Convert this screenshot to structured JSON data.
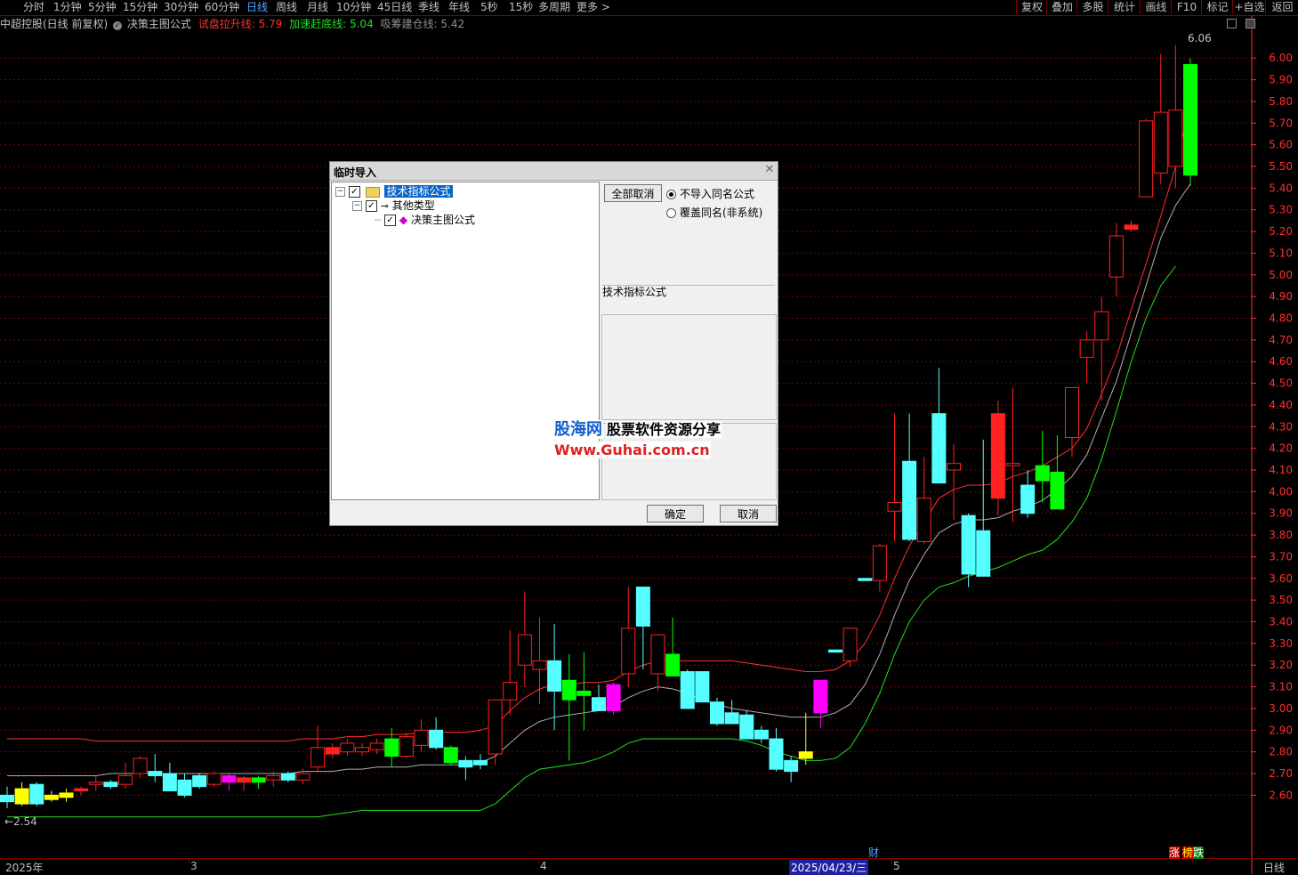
{
  "toolbar": {
    "periods": [
      "分时",
      "1分钟",
      "5分钟",
      "15分钟",
      "30分钟",
      "60分钟",
      "日线",
      "周线",
      "月线",
      "10分钟",
      "45日线",
      "季线",
      "年线",
      "5秒",
      "15秒",
      "多周期",
      "更多 >"
    ],
    "active_period": "日线",
    "right_buttons": [
      "复权",
      "叠加",
      "多股",
      "统计",
      "画线",
      "F10",
      "标记",
      "+自选",
      "返回"
    ]
  },
  "legend": {
    "stock": "中超控股(日线 前复权)",
    "formula": "决策主图公式",
    "line1_label": "试盘拉升线:",
    "line1_value": "5.79",
    "line2_label": "加速赶底线:",
    "line2_value": "5.04",
    "line3_label": "吸筹建仓线:",
    "line3_value": "5.42"
  },
  "annotations": {
    "high": "6.06",
    "low": "2.54",
    "fin_marker": "财",
    "zhang": "涨",
    "bang": "榜",
    "die": "跌"
  },
  "xaxis": {
    "year": "2025年",
    "m3": "3",
    "m4": "4",
    "m5": "5",
    "cursor_date": "2025/04/23/三",
    "period_label": "日线"
  },
  "dialog": {
    "title": "临时导入",
    "tree": {
      "root": "技术指标公式",
      "child": "其他类型",
      "leaf": "决策主图公式"
    },
    "cancel_all": "全部取消",
    "radio1": "不导入同名公式",
    "radio2": "覆盖同名(非系统)",
    "group_label": "技术指标公式",
    "ok": "确定",
    "cancel": "取消"
  },
  "watermark": {
    "brand": "股海网",
    "slogan": "股票软件资源分享",
    "url": "Www.Guhai.com.cn"
  },
  "colors": {
    "up": "#ff2020",
    "down": "#55ffff",
    "line1": "#ff3030",
    "line2": "#b0b0b0",
    "line3": "#20e020",
    "special_green": "#00ff00",
    "special_yellow": "#ffff00",
    "special_magenta": "#ff00ff",
    "grid": "#800000",
    "axis": "#ff3030"
  },
  "chart_data": {
    "type": "candlestick",
    "yticks": [
      2.6,
      2.7,
      2.8,
      2.9,
      3.0,
      3.1,
      3.2,
      3.3,
      3.4,
      3.5,
      3.6,
      3.7,
      3.8,
      3.9,
      4.0,
      4.1,
      4.2,
      4.3,
      4.4,
      4.5,
      4.6,
      4.7,
      4.8,
      4.9,
      5.0,
      5.1,
      5.2,
      5.3,
      5.4,
      5.5,
      5.6,
      5.7,
      5.8,
      5.9,
      6.0
    ],
    "ylim": [
      2.31,
      6.12
    ],
    "candles": [
      {
        "o": 2.6,
        "h": 2.64,
        "l": 2.54,
        "c": 2.57,
        "col": "cyan"
      },
      {
        "o": 2.63,
        "h": 2.66,
        "l": 2.55,
        "c": 2.56,
        "col": "yellow"
      },
      {
        "o": 2.56,
        "h": 2.66,
        "l": 2.55,
        "c": 2.65,
        "col": "cyan"
      },
      {
        "o": 2.6,
        "h": 2.62,
        "l": 2.57,
        "c": 2.58,
        "col": "yellow"
      },
      {
        "o": 2.61,
        "h": 2.63,
        "l": 2.57,
        "c": 2.59,
        "col": "yellow"
      },
      {
        "o": 2.63,
        "h": 2.64,
        "l": 2.6,
        "c": 2.62,
        "col": "red"
      },
      {
        "o": 2.65,
        "h": 2.69,
        "l": 2.62,
        "c": 2.66,
        "col": "red"
      },
      {
        "o": 2.66,
        "h": 2.67,
        "l": 2.63,
        "c": 2.64,
        "col": "cyan"
      },
      {
        "o": 2.65,
        "h": 2.75,
        "l": 2.63,
        "c": 2.69,
        "col": "red"
      },
      {
        "o": 2.7,
        "h": 2.78,
        "l": 2.68,
        "c": 2.77,
        "col": "red"
      },
      {
        "o": 2.71,
        "h": 2.79,
        "l": 2.66,
        "c": 2.69,
        "col": "cyan"
      },
      {
        "o": 2.7,
        "h": 2.75,
        "l": 2.65,
        "c": 2.62,
        "col": "cyan"
      },
      {
        "o": 2.67,
        "h": 2.7,
        "l": 2.59,
        "c": 2.6,
        "col": "cyan"
      },
      {
        "o": 2.69,
        "h": 2.7,
        "l": 2.63,
        "c": 2.64,
        "col": "cyan"
      },
      {
        "o": 2.65,
        "h": 2.71,
        "l": 2.64,
        "c": 2.7,
        "col": "red"
      },
      {
        "o": 2.69,
        "h": 2.7,
        "l": 2.62,
        "c": 2.66,
        "col": "magenta"
      },
      {
        "o": 2.68,
        "h": 2.69,
        "l": 2.62,
        "c": 2.66,
        "col": "red"
      },
      {
        "o": 2.66,
        "h": 2.69,
        "l": 2.63,
        "c": 2.68,
        "col": "green"
      },
      {
        "o": 2.67,
        "h": 2.71,
        "l": 2.64,
        "c": 2.69,
        "col": "red"
      },
      {
        "o": 2.7,
        "h": 2.71,
        "l": 2.66,
        "c": 2.67,
        "col": "cyan"
      },
      {
        "o": 2.67,
        "h": 2.72,
        "l": 2.65,
        "c": 2.7,
        "col": "red"
      },
      {
        "o": 2.73,
        "h": 2.92,
        "l": 2.71,
        "c": 2.82,
        "col": "red"
      },
      {
        "o": 2.82,
        "h": 2.84,
        "l": 2.77,
        "c": 2.79,
        "col": "red"
      },
      {
        "o": 2.8,
        "h": 2.86,
        "l": 2.78,
        "c": 2.84,
        "col": "red"
      },
      {
        "o": 2.8,
        "h": 2.84,
        "l": 2.78,
        "c": 2.82,
        "col": "red"
      },
      {
        "o": 2.81,
        "h": 2.86,
        "l": 2.79,
        "c": 2.84,
        "col": "red"
      },
      {
        "o": 2.86,
        "h": 2.91,
        "l": 2.73,
        "c": 2.78,
        "col": "green"
      },
      {
        "o": 2.78,
        "h": 2.89,
        "l": 2.77,
        "c": 2.87,
        "col": "red"
      },
      {
        "o": 2.83,
        "h": 2.95,
        "l": 2.8,
        "c": 2.9,
        "col": "red"
      },
      {
        "o": 2.9,
        "h": 2.96,
        "l": 2.81,
        "c": 2.82,
        "col": "cyan"
      },
      {
        "o": 2.82,
        "h": 2.83,
        "l": 2.74,
        "c": 2.75,
        "col": "green"
      },
      {
        "o": 2.76,
        "h": 2.78,
        "l": 2.67,
        "c": 2.73,
        "col": "cyan"
      },
      {
        "o": 2.76,
        "h": 2.79,
        "l": 2.72,
        "c": 2.74,
        "col": "cyan"
      },
      {
        "o": 2.79,
        "h": 3.04,
        "l": 2.74,
        "c": 3.04,
        "col": "red"
      },
      {
        "o": 3.04,
        "h": 3.36,
        "l": 2.97,
        "c": 3.12,
        "col": "red"
      },
      {
        "o": 3.2,
        "h": 3.54,
        "l": 3.1,
        "c": 3.34,
        "col": "red"
      },
      {
        "o": 3.18,
        "h": 3.42,
        "l": 3.02,
        "c": 3.22,
        "col": "red"
      },
      {
        "o": 3.22,
        "h": 3.39,
        "l": 2.9,
        "c": 3.08,
        "col": "cyan"
      },
      {
        "o": 3.13,
        "h": 3.25,
        "l": 2.76,
        "c": 3.04,
        "col": "green"
      },
      {
        "o": 3.08,
        "h": 3.26,
        "l": 2.9,
        "c": 3.06,
        "col": "green"
      },
      {
        "o": 3.05,
        "h": 3.11,
        "l": 2.99,
        "c": 2.99,
        "col": "cyan"
      },
      {
        "o": 2.99,
        "h": 3.12,
        "l": 2.97,
        "c": 3.11,
        "col": "magenta"
      },
      {
        "o": 3.16,
        "h": 3.56,
        "l": 3.1,
        "c": 3.37,
        "col": "red"
      },
      {
        "o": 3.56,
        "h": 3.56,
        "l": 3.18,
        "c": 3.38,
        "col": "cyan"
      },
      {
        "o": 3.16,
        "h": 3.28,
        "l": 3.08,
        "c": 3.34,
        "col": "red"
      },
      {
        "o": 3.25,
        "h": 3.42,
        "l": 3.17,
        "c": 3.15,
        "col": "green"
      },
      {
        "o": 3.17,
        "h": 3.18,
        "l": 3.0,
        "c": 3.0,
        "col": "cyan"
      },
      {
        "o": 3.17,
        "h": 3.17,
        "l": 3.03,
        "c": 3.03,
        "col": "cyan"
      },
      {
        "o": 3.03,
        "h": 3.05,
        "l": 2.92,
        "c": 2.93,
        "col": "cyan"
      },
      {
        "o": 2.98,
        "h": 3.04,
        "l": 2.94,
        "c": 2.93,
        "col": "cyan"
      },
      {
        "o": 2.97,
        "h": 2.99,
        "l": 2.86,
        "c": 2.86,
        "col": "cyan"
      },
      {
        "o": 2.9,
        "h": 2.92,
        "l": 2.84,
        "c": 2.86,
        "col": "cyan"
      },
      {
        "o": 2.86,
        "h": 2.91,
        "l": 2.71,
        "c": 2.72,
        "col": "cyan"
      },
      {
        "o": 2.76,
        "h": 2.78,
        "l": 2.66,
        "c": 2.71,
        "col": "cyan"
      },
      {
        "o": 2.77,
        "h": 2.98,
        "l": 2.74,
        "c": 2.8,
        "col": "yellow"
      },
      {
        "o": 2.98,
        "h": 3.13,
        "l": 2.91,
        "c": 3.13,
        "col": "magenta"
      },
      {
        "o": 3.26,
        "h": 3.27,
        "l": 3.26,
        "c": 3.27,
        "col": "cyan"
      },
      {
        "o": 3.22,
        "h": 3.37,
        "l": 3.19,
        "c": 3.37,
        "col": "red"
      },
      {
        "o": 3.59,
        "h": 3.6,
        "l": 3.59,
        "c": 3.6,
        "col": "cyan"
      },
      {
        "o": 3.59,
        "h": 3.76,
        "l": 3.54,
        "c": 3.75,
        "col": "red"
      },
      {
        "o": 3.91,
        "h": 4.36,
        "l": 3.77,
        "c": 3.95,
        "col": "red"
      },
      {
        "o": 4.14,
        "h": 4.36,
        "l": 3.77,
        "c": 3.78,
        "col": "cyan"
      },
      {
        "o": 3.77,
        "h": 4.16,
        "l": 3.76,
        "c": 3.97,
        "col": "red"
      },
      {
        "o": 4.36,
        "h": 4.57,
        "l": 4.04,
        "c": 4.04,
        "col": "cyan"
      },
      {
        "o": 4.1,
        "h": 4.22,
        "l": 3.87,
        "c": 4.13,
        "col": "red"
      },
      {
        "o": 3.89,
        "h": 3.9,
        "l": 3.56,
        "c": 3.62,
        "col": "cyan"
      },
      {
        "o": 3.82,
        "h": 4.24,
        "l": 3.61,
        "c": 3.61,
        "col": "cyan"
      },
      {
        "o": 4.36,
        "h": 4.42,
        "l": 3.89,
        "c": 3.97,
        "col": "red"
      },
      {
        "o": 4.12,
        "h": 4.48,
        "l": 3.86,
        "c": 4.13,
        "col": "red"
      },
      {
        "o": 4.03,
        "h": 4.1,
        "l": 3.88,
        "c": 3.9,
        "col": "cyan"
      },
      {
        "o": 4.12,
        "h": 4.28,
        "l": 3.95,
        "c": 4.05,
        "col": "green"
      },
      {
        "o": 4.09,
        "h": 4.26,
        "l": 3.93,
        "c": 3.92,
        "col": "green"
      },
      {
        "o": 4.25,
        "h": 4.47,
        "l": 4.16,
        "c": 4.48,
        "col": "red"
      },
      {
        "o": 4.62,
        "h": 4.74,
        "l": 4.5,
        "c": 4.7,
        "col": "red"
      },
      {
        "o": 4.7,
        "h": 4.9,
        "l": 4.42,
        "c": 4.83,
        "col": "red"
      },
      {
        "o": 4.99,
        "h": 5.24,
        "l": 4.9,
        "c": 5.18,
        "col": "red"
      },
      {
        "o": 5.23,
        "h": 5.25,
        "l": 5.2,
        "c": 5.21,
        "col": "red"
      },
      {
        "o": 5.36,
        "h": 5.72,
        "l": 5.36,
        "c": 5.71,
        "col": "red"
      },
      {
        "o": 5.47,
        "h": 6.02,
        "l": 5.42,
        "c": 5.75,
        "col": "red"
      },
      {
        "o": 5.5,
        "h": 6.06,
        "l": 5.4,
        "c": 5.76,
        "col": "red"
      },
      {
        "o": 5.46,
        "h": 6.0,
        "l": 5.41,
        "c": 5.97,
        "col": "green"
      }
    ],
    "overlays": [
      {
        "name": "试盘拉升线",
        "color": "red",
        "values": [
          2.86,
          2.86,
          2.86,
          2.86,
          2.86,
          2.86,
          2.85,
          2.85,
          2.85,
          2.85,
          2.85,
          2.85,
          2.85,
          2.85,
          2.85,
          2.85,
          2.85,
          2.85,
          2.85,
          2.85,
          2.86,
          2.86,
          2.86,
          2.87,
          2.87,
          2.88,
          2.88,
          2.88,
          2.89,
          2.89,
          2.89,
          2.89,
          2.9,
          2.92,
          2.99,
          3.05,
          3.09,
          3.11,
          3.11,
          3.12,
          3.12,
          3.13,
          3.17,
          3.2,
          3.22,
          3.22,
          3.22,
          3.22,
          3.22,
          3.22,
          3.21,
          3.2,
          3.19,
          3.18,
          3.17,
          3.17,
          3.18,
          3.22,
          3.3,
          3.43,
          3.6,
          3.75,
          3.86,
          3.97,
          4.01,
          4.03,
          4.03,
          4.04,
          4.07,
          4.09,
          4.12,
          4.16,
          4.2,
          4.29,
          4.45,
          4.62,
          4.84,
          5.05,
          5.27,
          5.5,
          5.79
        ]
      },
      {
        "name": "吸筹建仓线",
        "color": "gray",
        "values": [
          2.69,
          2.69,
          2.69,
          2.69,
          2.69,
          2.69,
          2.69,
          2.7,
          2.7,
          2.7,
          2.7,
          2.7,
          2.7,
          2.7,
          2.7,
          2.7,
          2.7,
          2.7,
          2.7,
          2.7,
          2.71,
          2.71,
          2.71,
          2.72,
          2.72,
          2.73,
          2.73,
          2.73,
          2.74,
          2.74,
          2.74,
          2.74,
          2.75,
          2.78,
          2.84,
          2.9,
          2.94,
          2.96,
          2.97,
          2.98,
          2.99,
          3.01,
          3.05,
          3.08,
          3.1,
          3.09,
          3.07,
          3.04,
          3.02,
          3.0,
          2.99,
          2.98,
          2.97,
          2.96,
          2.96,
          2.96,
          2.98,
          3.02,
          3.11,
          3.25,
          3.43,
          3.59,
          3.71,
          3.81,
          3.85,
          3.87,
          3.87,
          3.88,
          3.91,
          3.93,
          3.96,
          4.01,
          4.07,
          4.17,
          4.34,
          4.51,
          4.73,
          4.95,
          5.17,
          5.32,
          5.42
        ]
      },
      {
        "name": "加速赶底线",
        "color": "green",
        "values": [
          2.5,
          2.5,
          2.5,
          2.5,
          2.5,
          2.5,
          2.5,
          2.5,
          2.5,
          2.5,
          2.5,
          2.5,
          2.5,
          2.5,
          2.5,
          2.5,
          2.5,
          2.5,
          2.5,
          2.5,
          2.5,
          2.5,
          2.51,
          2.52,
          2.53,
          2.53,
          2.53,
          2.53,
          2.53,
          2.53,
          2.53,
          2.53,
          2.53,
          2.56,
          2.62,
          2.68,
          2.72,
          2.73,
          2.74,
          2.75,
          2.77,
          2.8,
          2.84,
          2.86,
          2.86,
          2.86,
          2.86,
          2.86,
          2.86,
          2.86,
          2.85,
          2.83,
          2.8,
          2.78,
          2.76,
          2.76,
          2.77,
          2.82,
          2.93,
          3.07,
          3.25,
          3.4,
          3.5,
          3.56,
          3.58,
          3.61,
          3.63,
          3.65,
          3.68,
          3.71,
          3.73,
          3.78,
          3.86,
          3.97,
          4.15,
          4.37,
          4.6,
          4.8,
          4.95,
          5.04
        ]
      }
    ]
  }
}
